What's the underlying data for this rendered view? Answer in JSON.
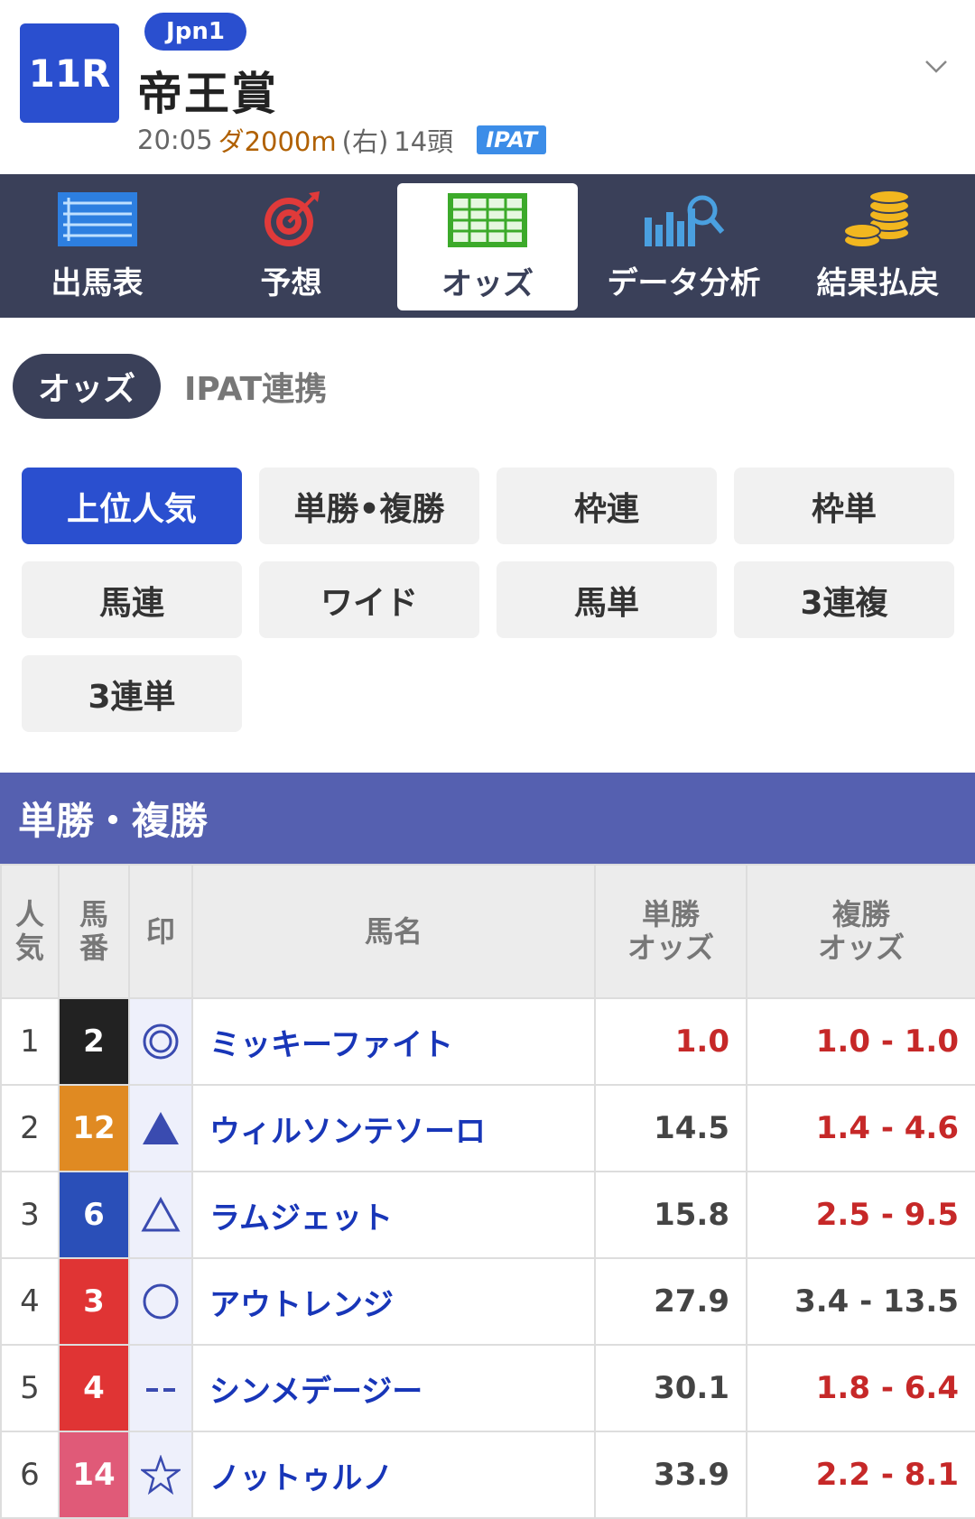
{
  "header": {
    "race_number": "11R",
    "grade": "Jpn1",
    "race_name": "帝王賞",
    "time": "20:05",
    "course": "ダ2000m",
    "direction": "(右)",
    "runners": "14頭",
    "ipat": "IPAT"
  },
  "nav": [
    {
      "label": "出馬表",
      "icon": "entry-list-icon"
    },
    {
      "label": "予想",
      "icon": "target-icon"
    },
    {
      "label": "オッズ",
      "icon": "odds-sheet-icon"
    },
    {
      "label": "データ分析",
      "icon": "analytics-icon"
    },
    {
      "label": "結果払戻",
      "icon": "coins-icon"
    }
  ],
  "subtabs": {
    "active": "オッズ",
    "other": "IPAT連携"
  },
  "filters": [
    "上位人気",
    "単勝•複勝",
    "枠連",
    "枠単",
    "馬連",
    "ワイド",
    "馬単",
    "3連複",
    "3連単"
  ],
  "section_title": "単勝・複勝",
  "table": {
    "headers": {
      "rank": "人気",
      "number": "馬番",
      "mark": "印",
      "name": "馬名",
      "win": "単勝\nオッズ",
      "place": "複勝\nオッズ"
    },
    "rows": [
      {
        "rank": "1",
        "number": "2",
        "mark": "double-circle",
        "name": "ミッキーファイト",
        "win": "1.0",
        "place": "1.0 - 1.0",
        "frame_color": "#222222",
        "win_hot": true,
        "place_hot": true
      },
      {
        "rank": "2",
        "number": "12",
        "mark": "filled-triangle",
        "name": "ウィルソンテソーロ",
        "win": "14.5",
        "place": "1.4 - 4.6",
        "frame_color": "#e08a22",
        "win_hot": false,
        "place_hot": true
      },
      {
        "rank": "3",
        "number": "6",
        "mark": "open-triangle",
        "name": "ラムジェット",
        "win": "15.8",
        "place": "2.5 - 9.5",
        "frame_color": "#2a4fb8",
        "win_hot": false,
        "place_hot": true
      },
      {
        "rank": "4",
        "number": "3",
        "mark": "circle",
        "name": "アウトレンジ",
        "win": "27.9",
        "place": "3.4 - 13.5",
        "frame_color": "#e03434",
        "win_hot": false,
        "place_hot": false
      },
      {
        "rank": "5",
        "number": "4",
        "mark": "dash",
        "name": "シンメデージー",
        "win": "30.1",
        "place": "1.8 - 6.4",
        "frame_color": "#e03434",
        "win_hot": false,
        "place_hot": true
      },
      {
        "rank": "6",
        "number": "14",
        "mark": "star",
        "name": "ノットゥルノ",
        "win": "33.9",
        "place": "2.2 - 8.1",
        "frame_color": "#e05a78",
        "win_hot": false,
        "place_hot": true
      }
    ]
  },
  "colors": {
    "accent": "#2a4fcf",
    "nav_bg": "#3a4059",
    "section_bg": "#5560b0",
    "odds_hot": "#c62828",
    "horse_name": "#1836b8"
  }
}
